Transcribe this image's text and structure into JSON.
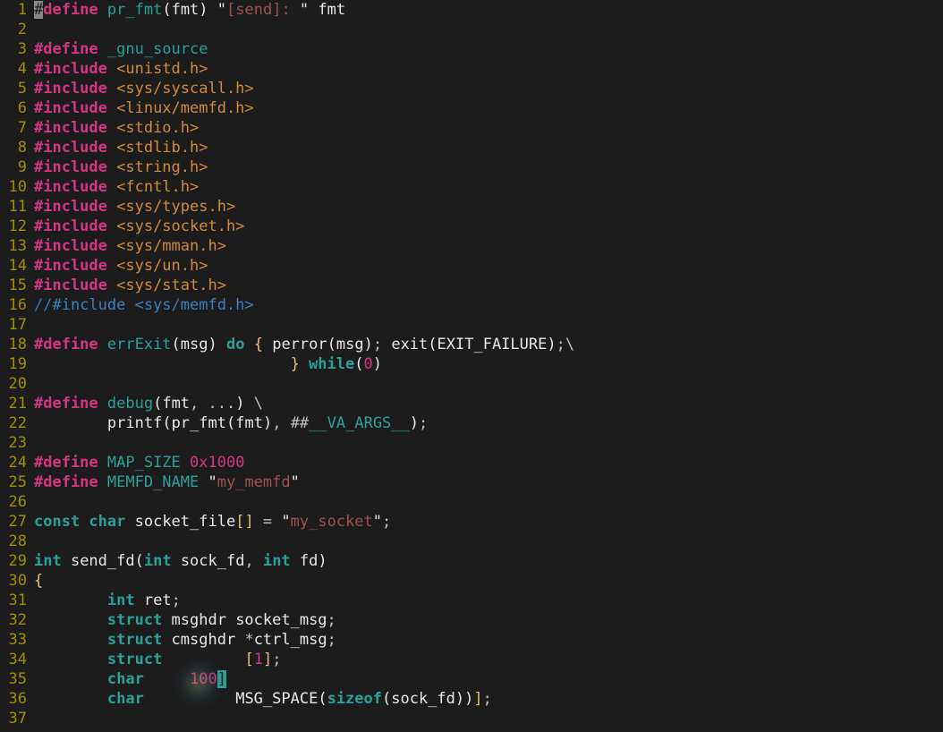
{
  "first_line_number": 1,
  "lines": [
    {
      "t": [
        [
          "cursor",
          "#"
        ],
        [
          "directive",
          "define "
        ],
        [
          "macroName",
          "pr_fmt"
        ],
        [
          "paren",
          "("
        ],
        [
          "ident",
          "fmt"
        ],
        [
          "paren",
          ") "
        ],
        [
          "stringQuote",
          "\""
        ],
        [
          "string",
          "[send]: "
        ],
        [
          "stringQuote",
          "\" "
        ],
        [
          "ident",
          "fmt"
        ]
      ]
    },
    {
      "t": []
    },
    {
      "t": [
        [
          "directive",
          "#define "
        ],
        [
          "macroName",
          "_gnu_source"
        ]
      ]
    },
    {
      "t": [
        [
          "directive",
          "#include "
        ],
        [
          "header",
          "<unistd.h>"
        ]
      ]
    },
    {
      "t": [
        [
          "directive",
          "#include "
        ],
        [
          "header",
          "<sys/syscall.h>"
        ]
      ]
    },
    {
      "t": [
        [
          "directive",
          "#include "
        ],
        [
          "header",
          "<linux/memfd.h>"
        ]
      ]
    },
    {
      "t": [
        [
          "directive",
          "#include "
        ],
        [
          "header",
          "<stdio.h>"
        ]
      ]
    },
    {
      "t": [
        [
          "directive",
          "#include "
        ],
        [
          "header",
          "<stdlib.h>"
        ]
      ]
    },
    {
      "t": [
        [
          "directive",
          "#include "
        ],
        [
          "header",
          "<string.h>"
        ]
      ]
    },
    {
      "t": [
        [
          "directive",
          "#include "
        ],
        [
          "header",
          "<fcntl.h>"
        ]
      ]
    },
    {
      "t": [
        [
          "directive",
          "#include "
        ],
        [
          "header",
          "<sys/types.h>"
        ]
      ]
    },
    {
      "t": [
        [
          "directive",
          "#include "
        ],
        [
          "header",
          "<sys/socket.h>"
        ]
      ]
    },
    {
      "t": [
        [
          "directive",
          "#include "
        ],
        [
          "header",
          "<sys/mman.h>"
        ]
      ]
    },
    {
      "t": [
        [
          "directive",
          "#include "
        ],
        [
          "header",
          "<sys/un.h>"
        ]
      ]
    },
    {
      "t": [
        [
          "directive",
          "#include "
        ],
        [
          "header",
          "<sys/stat.h>"
        ]
      ]
    },
    {
      "t": [
        [
          "comment",
          "//#include <sys/memfd.h>"
        ]
      ]
    },
    {
      "t": []
    },
    {
      "t": [
        [
          "directive",
          "#define "
        ],
        [
          "macroName",
          "errExit"
        ],
        [
          "paren",
          "("
        ],
        [
          "ident",
          "msg"
        ],
        [
          "paren",
          ") "
        ],
        [
          "keyword",
          "do "
        ],
        [
          "brace",
          "{ "
        ],
        [
          "ident",
          "perror"
        ],
        [
          "paren",
          "("
        ],
        [
          "ident",
          "msg"
        ],
        [
          "paren",
          ")"
        ],
        [
          "punct",
          "; "
        ],
        [
          "ident",
          "exit"
        ],
        [
          "paren",
          "("
        ],
        [
          "ident",
          "EXIT_FAILURE"
        ],
        [
          "paren",
          ")"
        ],
        [
          "punct",
          ";"
        ],
        [
          "op",
          "\\"
        ]
      ]
    },
    {
      "t": [
        [
          "ident",
          "                            "
        ],
        [
          "brace",
          "} "
        ],
        [
          "keyword",
          "while"
        ],
        [
          "paren",
          "("
        ],
        [
          "number",
          "0"
        ],
        [
          "paren",
          ")"
        ]
      ]
    },
    {
      "t": []
    },
    {
      "t": [
        [
          "directive",
          "#define "
        ],
        [
          "macroName",
          "debug"
        ],
        [
          "paren",
          "("
        ],
        [
          "ident",
          "fmt"
        ],
        [
          "punct",
          ", "
        ],
        [
          "op",
          "..."
        ],
        [
          "paren",
          ") "
        ],
        [
          "op",
          "\\"
        ]
      ]
    },
    {
      "t": [
        [
          "ident",
          "        "
        ],
        [
          "ident",
          "printf"
        ],
        [
          "paren",
          "("
        ],
        [
          "ident",
          "pr_fmt"
        ],
        [
          "paren",
          "("
        ],
        [
          "ident",
          "fmt"
        ],
        [
          "paren",
          ")"
        ],
        [
          "punct",
          ", "
        ],
        [
          "op",
          "##"
        ],
        [
          "vaargs",
          "__VA_ARGS__"
        ],
        [
          "paren",
          ")"
        ],
        [
          "punct",
          ";"
        ]
      ]
    },
    {
      "t": []
    },
    {
      "t": [
        [
          "directive",
          "#define "
        ],
        [
          "macroName",
          "MAP_SIZE "
        ],
        [
          "number",
          "0x1000"
        ]
      ]
    },
    {
      "t": [
        [
          "directive",
          "#define "
        ],
        [
          "macroName",
          "MEMFD_NAME "
        ],
        [
          "stringQuote",
          "\""
        ],
        [
          "string",
          "my_memfd"
        ],
        [
          "stringQuote",
          "\""
        ]
      ]
    },
    {
      "t": []
    },
    {
      "t": [
        [
          "keyword",
          "const "
        ],
        [
          "type",
          "char "
        ],
        [
          "ident",
          "socket_file"
        ],
        [
          "brace",
          "[] "
        ],
        [
          "op",
          "= "
        ],
        [
          "stringQuote",
          "\""
        ],
        [
          "string",
          "my_socket"
        ],
        [
          "stringQuote",
          "\""
        ],
        [
          "punct",
          ";"
        ]
      ]
    },
    {
      "t": []
    },
    {
      "t": [
        [
          "type",
          "int "
        ],
        [
          "ident",
          "send_fd"
        ],
        [
          "paren",
          "("
        ],
        [
          "type",
          "int "
        ],
        [
          "ident",
          "sock_fd"
        ],
        [
          "punct",
          ", "
        ],
        [
          "type",
          "int "
        ],
        [
          "ident",
          "fd"
        ],
        [
          "paren",
          ")"
        ]
      ]
    },
    {
      "t": [
        [
          "brace",
          "{"
        ]
      ]
    },
    {
      "t": [
        [
          "ident",
          "        "
        ],
        [
          "type",
          "int "
        ],
        [
          "ident",
          "ret"
        ],
        [
          "punct",
          ";"
        ]
      ]
    },
    {
      "t": [
        [
          "ident",
          "        "
        ],
        [
          "keyword",
          "struct "
        ],
        [
          "ident",
          "msghdr socket_msg"
        ],
        [
          "punct",
          ";"
        ]
      ]
    },
    {
      "t": [
        [
          "ident",
          "        "
        ],
        [
          "keyword",
          "struct "
        ],
        [
          "ident",
          "cmsghdr "
        ],
        [
          "op",
          "*"
        ],
        [
          "ident",
          "ctrl_msg"
        ],
        [
          "punct",
          ";"
        ]
      ]
    },
    {
      "t": [
        [
          "ident",
          "        "
        ],
        [
          "keyword",
          "struct "
        ],
        [
          "ident",
          "        "
        ],
        [
          "brace",
          "["
        ],
        [
          "number",
          "1"
        ],
        [
          "brace",
          "]"
        ],
        [
          "punct",
          ";"
        ]
      ]
    },
    {
      "t": [
        [
          "ident",
          "        "
        ],
        [
          "type",
          "char "
        ],
        [
          "ident",
          "    "
        ],
        [
          "number",
          "100"
        ],
        [
          "hlbracket",
          "]"
        ]
      ]
    },
    {
      "t": [
        [
          "ident",
          "        "
        ],
        [
          "type",
          "char "
        ],
        [
          "ident",
          "         "
        ],
        [
          "ident",
          "MSG_SPACE"
        ],
        [
          "paren",
          "("
        ],
        [
          "keyword",
          "sizeof"
        ],
        [
          "paren",
          "("
        ],
        [
          "ident",
          "sock_fd"
        ],
        [
          "paren",
          "))"
        ],
        [
          "brace",
          "]"
        ],
        [
          "punct",
          ";"
        ]
      ]
    },
    {
      "t": []
    }
  ]
}
